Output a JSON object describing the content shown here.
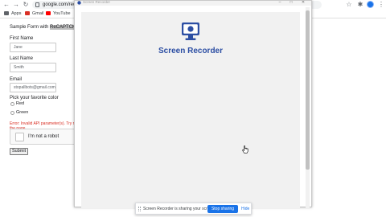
{
  "browser": {
    "url": "google.com/reca",
    "bookmarks": [
      {
        "label": "Apps",
        "icon": "apps-grid-icon",
        "color": "#5f6368"
      },
      {
        "label": "Gmail",
        "icon": "gmail-icon",
        "color": "#d93025"
      },
      {
        "label": "YouTube",
        "icon": "youtube-icon",
        "color": "#ff0000"
      }
    ]
  },
  "form": {
    "heading": "Sample Form with ",
    "heading_highlight": "ReCAPTCHA",
    "first_name": {
      "label": "First Name",
      "value": "Jane"
    },
    "last_name": {
      "label": "Last Name",
      "value": "Smith"
    },
    "email": {
      "label": "Email",
      "value": "stopallbots@gmail.com"
    },
    "color_prompt": "Pick your favorite color",
    "colors": [
      "Red",
      "Green"
    ],
    "error_line1": "Error: Invalid API parameter(s). Try reloa",
    "error_line2": "the page.",
    "captcha_label": "I'm not a robot",
    "submit_label": "Submit"
  },
  "recorder": {
    "window_title": "Screen Recorder",
    "title": "Screen Recorder",
    "brand_color": "#2c4ea3"
  },
  "sharing_bar": {
    "message": "Screen Recorder is sharing your screen.",
    "stop_label": "Stop sharing",
    "hide_label": "Hide"
  }
}
